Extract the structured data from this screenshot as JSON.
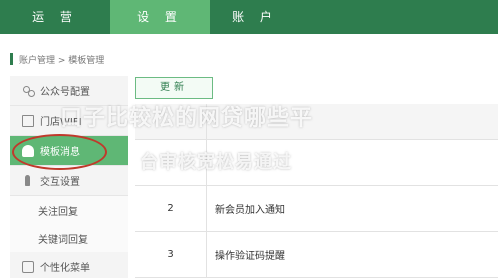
{
  "nav": {
    "tabs": [
      "运 营",
      "设 置",
      "账 户"
    ],
    "active_index": 1
  },
  "breadcrumb": {
    "text": "账户管理 > 模板管理"
  },
  "sidebar": {
    "items": [
      {
        "label": "公众号配置",
        "icon": "people-icon"
      },
      {
        "label": "门店WIFI",
        "icon": "store-icon"
      },
      {
        "label": "模板消息",
        "icon": "template-icon",
        "active": true
      },
      {
        "label": "交互设置",
        "icon": "interaction-icon"
      },
      {
        "label": "关注回复",
        "sub": true
      },
      {
        "label": "关键词回复",
        "sub": true
      },
      {
        "label": "个性化菜单",
        "icon": "menu-icon"
      }
    ]
  },
  "toolbar": {
    "update_label": "更新"
  },
  "table": {
    "rows": [
      {
        "num": "2",
        "name": "新会员加入通知"
      },
      {
        "num": "3",
        "name": "操作验证码提醒"
      }
    ]
  },
  "watermark": {
    "line1": "口子比较松的网贷哪些平",
    "line2": "台审核宽松易通过"
  },
  "colors": {
    "nav_bg": "#2e7d4e",
    "accent": "#5fb775",
    "annotation": "#c0392b"
  }
}
